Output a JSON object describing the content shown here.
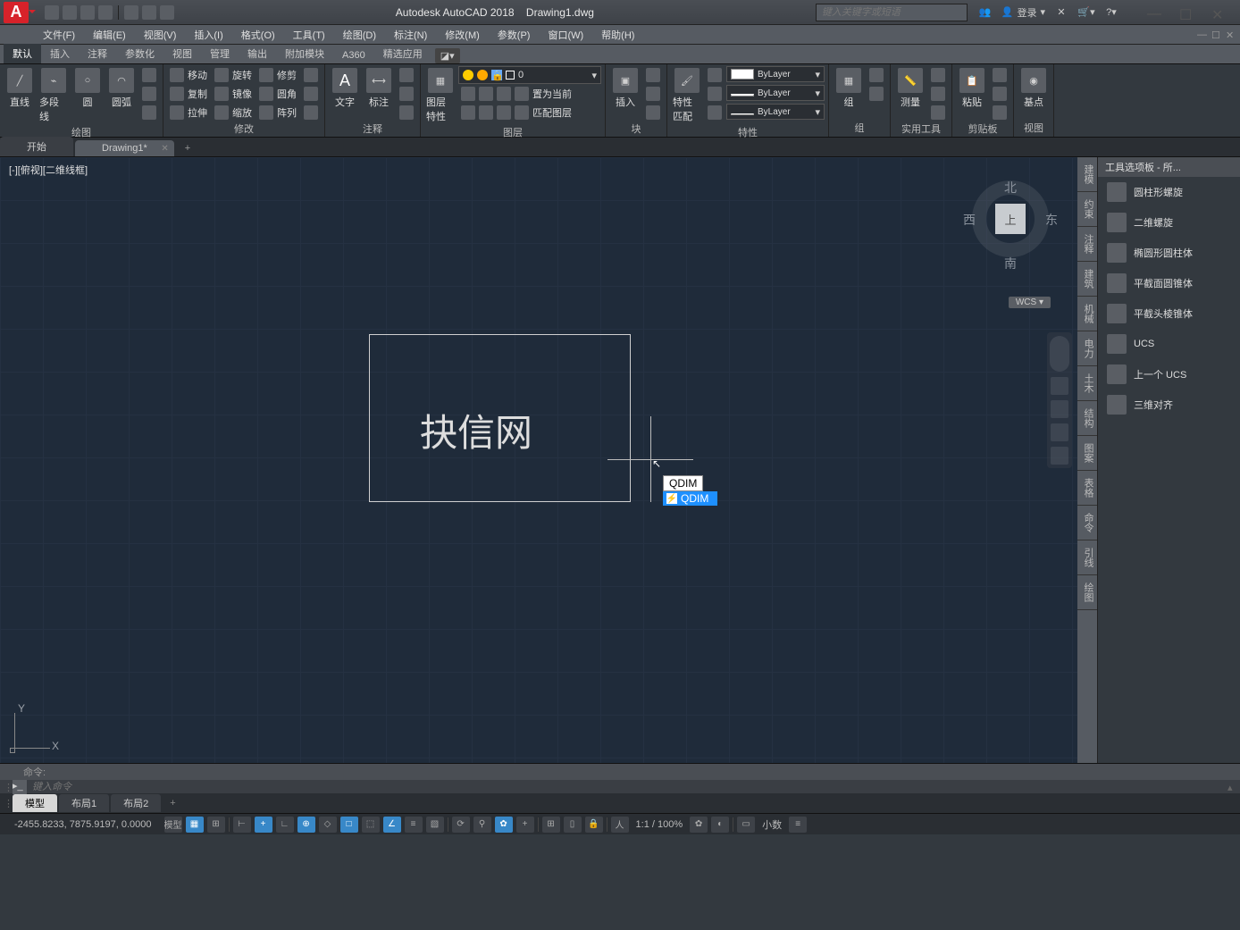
{
  "title": {
    "app": "Autodesk AutoCAD 2018",
    "doc": "Drawing1.dwg",
    "search_ph": "键入关键字或短语",
    "login": "登录"
  },
  "menubar": [
    "文件(F)",
    "编辑(E)",
    "视图(V)",
    "插入(I)",
    "格式(O)",
    "工具(T)",
    "绘图(D)",
    "标注(N)",
    "修改(M)",
    "参数(P)",
    "窗口(W)",
    "帮助(H)"
  ],
  "ribbon_tabs": [
    "默认",
    "插入",
    "注释",
    "参数化",
    "视图",
    "管理",
    "输出",
    "附加模块",
    "A360",
    "精选应用"
  ],
  "ribbon": {
    "draw": {
      "title": "绘图",
      "btns": [
        "直线",
        "多段线",
        "圆",
        "圆弧"
      ]
    },
    "modify": {
      "title": "修改",
      "rows": [
        [
          "移动",
          "旋转",
          "修剪"
        ],
        [
          "复制",
          "镜像",
          "圆角"
        ],
        [
          "拉伸",
          "缩放",
          "阵列"
        ]
      ]
    },
    "annot": {
      "title": "注释",
      "btns": [
        "文字",
        "标注"
      ]
    },
    "layer": {
      "title": "图层",
      "main": "图层特性",
      "combo": "0",
      "rows": [
        [
          "",
          "",
          "置为当前"
        ],
        [
          "",
          "",
          "匹配图层"
        ]
      ]
    },
    "block": {
      "title": "块",
      "main": "插入"
    },
    "prop": {
      "title": "特性",
      "main": "特性匹配",
      "by1": "ByLayer",
      "by2": "ByLayer",
      "by3": "ByLayer"
    },
    "group": {
      "title": "组",
      "main": "组"
    },
    "util": {
      "title": "实用工具",
      "main": "测量"
    },
    "clip": {
      "title": "剪贴板",
      "main": "粘贴"
    },
    "view": {
      "title": "视图",
      "main": "基点"
    }
  },
  "doctabs": {
    "start": "开始",
    "active": "Drawing1*"
  },
  "canvas": {
    "viewport": "[-][俯视][二维线框]",
    "watermark": "抉信网",
    "input": "QDIM",
    "suggest": "QDIM",
    "viewcube": {
      "face": "上",
      "n": "北",
      "s": "南",
      "e": "东",
      "w": "西"
    },
    "wcs": "WCS",
    "ucs_y": "Y",
    "ucs_x": "X"
  },
  "palette_rail": [
    "建模",
    "约束",
    "注释",
    "建筑",
    "机械",
    "电力",
    "土木",
    "结构",
    "图案",
    "表格",
    "命令",
    "引线",
    "绘图"
  ],
  "palette": {
    "title": "工具选项板 - 所...",
    "items": [
      "圆柱形螺旋",
      "二维螺旋",
      "椭圆形圆柱体",
      "平截面圆锥体",
      "平截头棱锥体",
      "UCS",
      "上一个 UCS",
      "三维对齐"
    ]
  },
  "cmdline": {
    "hist": "命令:",
    "ph": "键入命令"
  },
  "layout_tabs": [
    "模型",
    "布局1",
    "布局2"
  ],
  "statusbar": {
    "coords": "-2455.8233, 7875.9197, 0.0000",
    "mode": "模型",
    "scale": "1:1 / 100%",
    "snap": "小数"
  }
}
